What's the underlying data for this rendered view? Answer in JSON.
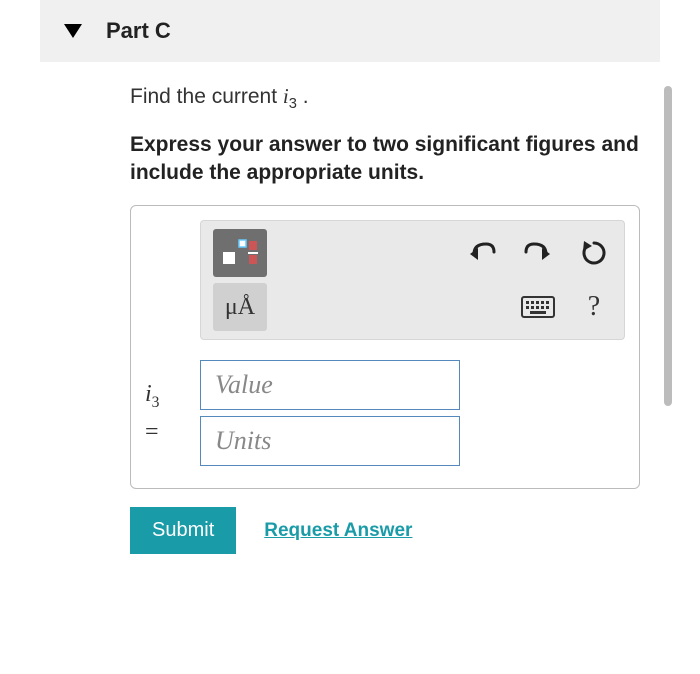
{
  "part": {
    "title": "Part C"
  },
  "question": {
    "prefix": "Find the current ",
    "var": "i",
    "sub": "3",
    "suffix": " ."
  },
  "instructions": "Express your answer to two significant figures and include the appropriate units.",
  "toolbar": {
    "special_units_label": "μÅ"
  },
  "answer": {
    "var": "i",
    "sub": "3",
    "eq": "=",
    "value_placeholder": "Value",
    "units_placeholder": "Units"
  },
  "actions": {
    "submit_label": "Submit",
    "request_label": "Request Answer"
  }
}
